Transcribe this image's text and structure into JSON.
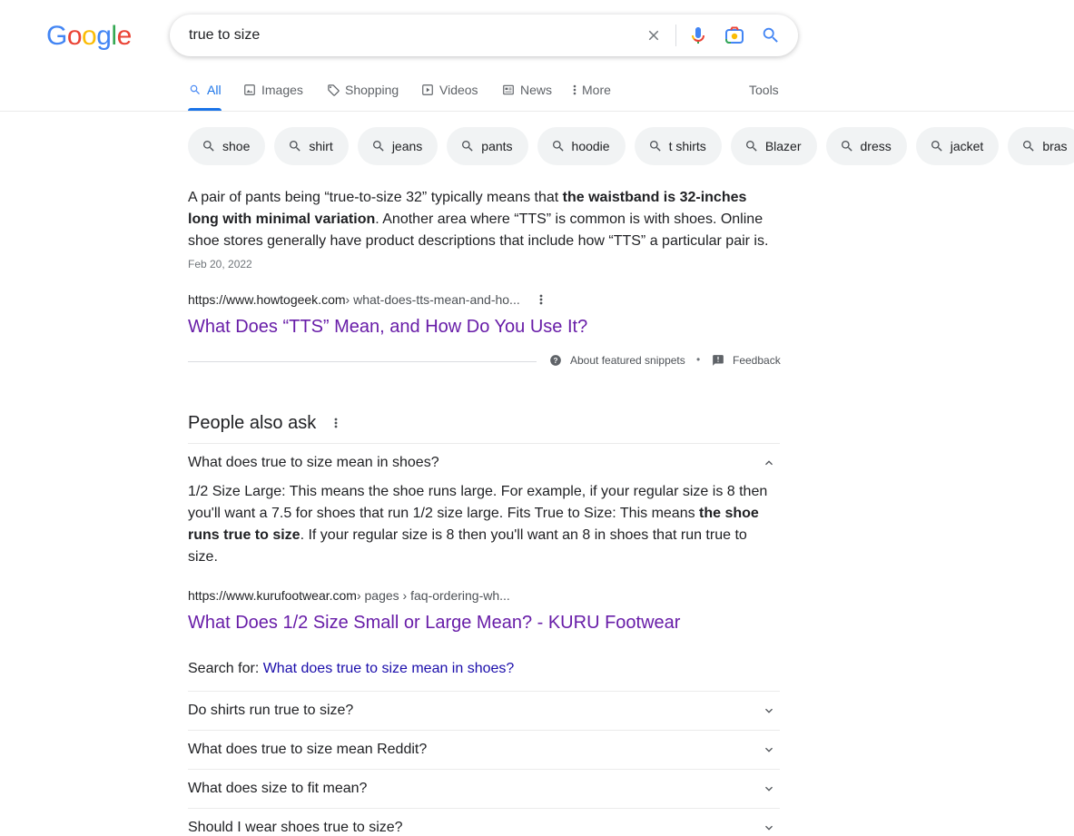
{
  "logo": {
    "letters": [
      {
        "ch": "G",
        "color": "#4285F4"
      },
      {
        "ch": "o",
        "color": "#EA4335"
      },
      {
        "ch": "o",
        "color": "#FBBC05"
      },
      {
        "ch": "g",
        "color": "#4285F4"
      },
      {
        "ch": "l",
        "color": "#34A853"
      },
      {
        "ch": "e",
        "color": "#EA4335"
      }
    ]
  },
  "search": {
    "query": "true to size",
    "icons": [
      "close-icon",
      "microphone-icon",
      "camera-lens-icon",
      "search-icon"
    ]
  },
  "tabs": [
    {
      "label": "All",
      "icon": "search-icon",
      "active": true
    },
    {
      "label": "Images",
      "icon": "image-icon",
      "active": false
    },
    {
      "label": "Shopping",
      "icon": "tag-icon",
      "active": false
    },
    {
      "label": "Videos",
      "icon": "play-icon",
      "active": false
    },
    {
      "label": "News",
      "icon": "newspaper-icon",
      "active": false
    },
    {
      "label": "More",
      "icon": "more-vertical-icon",
      "active": false
    }
  ],
  "tools_label": "Tools",
  "chips": [
    "shoe",
    "shirt",
    "jeans",
    "pants",
    "hoodie",
    "t shirts",
    "Blazer",
    "dress",
    "jacket",
    "bras"
  ],
  "snippet": {
    "text_before": "A pair of pants being “true-to-size 32” typically means that ",
    "text_bold": "the waistband is 32-inches long with minimal variation",
    "text_after": ". Another area where “TTS” is common is with shoes. Online shoe stores generally have product descriptions that include how “TTS” a particular pair is.",
    "date": "Feb 20, 2022",
    "cite_domain": "https://www.howtogeek.com",
    "cite_path": " › what-does-tts-mean-and-ho...",
    "title": "What Does “TTS” Mean, and How Do You Use It?",
    "about_label": "About featured snippets",
    "bullet": "•",
    "feedback_label": "Feedback"
  },
  "paa": {
    "heading": "People also ask",
    "expanded": {
      "question": "What does true to size mean in shoes?",
      "answer_before": "1/2 Size Large: This means the shoe runs large. For example, if your regular size is 8 then you'll want a 7.5 for shoes that run 1/2 size large. Fits True to Size: This means ",
      "answer_bold": "the shoe runs true to size",
      "answer_after": ". If your regular size is 8 then you'll want an 8 in shoes that run true to size.",
      "cite_domain": "https://www.kurufootwear.com",
      "cite_path": " › pages › faq-ordering-wh...",
      "title": "What Does 1/2 Size Small or Large Mean? - KURU Footwear",
      "search_for_label": "Search for: ",
      "search_for_link": "What does true to size mean in shoes?"
    },
    "questions": [
      "Do shirts run true to size?",
      "What does true to size mean Reddit?",
      "What does size to fit mean?",
      "Should I wear shoes true to size?"
    ]
  }
}
